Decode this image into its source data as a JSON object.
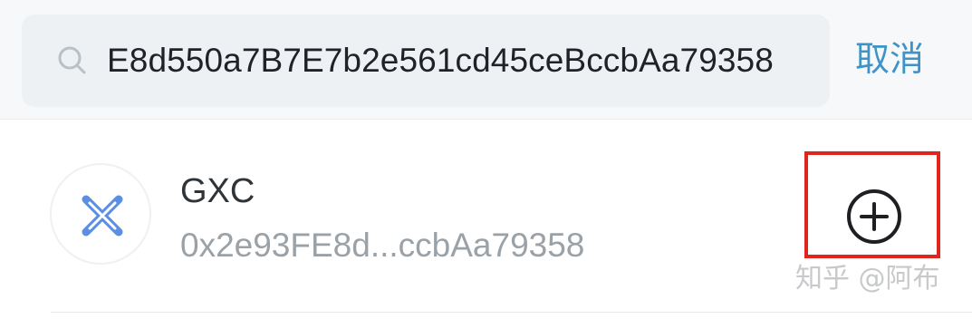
{
  "search": {
    "value": "E8d550a7B7E7b2e561cd45ceBccbAa79358",
    "icon": "search-icon",
    "cancel_label": "取消"
  },
  "result": {
    "symbol": "GXC",
    "address": "0x2e93FE8d...ccbAa79358",
    "logo_icon": "gxc-logo",
    "add_icon": "plus-circle-icon"
  },
  "watermark": "知乎 @阿布",
  "colors": {
    "accent": "#3f93c7",
    "highlight": "#e0251f",
    "logo": "#5b8fe3",
    "search_bg": "#eef1f4"
  }
}
